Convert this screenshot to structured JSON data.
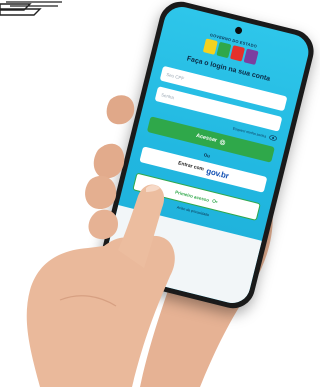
{
  "phone_screen": {
    "brand_title": "GOVERNO DO ESTADO",
    "login_title": "Faça o login na sua conta",
    "cpf_placeholder": "Seu CPF",
    "password_placeholder": "Senha",
    "show_password_label": "Esqueci minha senha",
    "submit_label": "Acessar",
    "divider_text": "Ou",
    "govbr_prefix": "Entrar com",
    "govbr_brand": "gov.br",
    "first_access_label": "Primeiro acesso",
    "footer_text": "Aviso de privacidade"
  },
  "colors": {
    "screen_bg": "#21b7e0",
    "primary_green": "#2fa84a",
    "govbr_blue": "#1351b4",
    "skin": "#e9b89a"
  },
  "icons": {
    "corner": "stack-lines-icon",
    "camera": "camera-icon",
    "eye": "eye-icon",
    "submit": "fingerprint-icon",
    "first_access": "key-icon"
  }
}
